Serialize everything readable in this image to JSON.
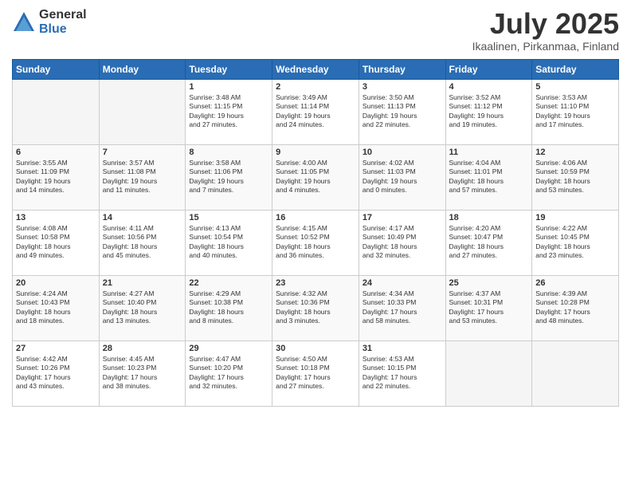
{
  "logo": {
    "general": "General",
    "blue": "Blue"
  },
  "header": {
    "month": "July 2025",
    "location": "Ikaalinen, Pirkanmaa, Finland"
  },
  "weekdays": [
    "Sunday",
    "Monday",
    "Tuesday",
    "Wednesday",
    "Thursday",
    "Friday",
    "Saturday"
  ],
  "weeks": [
    [
      {
        "day": "",
        "info": ""
      },
      {
        "day": "",
        "info": ""
      },
      {
        "day": "1",
        "info": "Sunrise: 3:48 AM\nSunset: 11:15 PM\nDaylight: 19 hours\nand 27 minutes."
      },
      {
        "day": "2",
        "info": "Sunrise: 3:49 AM\nSunset: 11:14 PM\nDaylight: 19 hours\nand 24 minutes."
      },
      {
        "day": "3",
        "info": "Sunrise: 3:50 AM\nSunset: 11:13 PM\nDaylight: 19 hours\nand 22 minutes."
      },
      {
        "day": "4",
        "info": "Sunrise: 3:52 AM\nSunset: 11:12 PM\nDaylight: 19 hours\nand 19 minutes."
      },
      {
        "day": "5",
        "info": "Sunrise: 3:53 AM\nSunset: 11:10 PM\nDaylight: 19 hours\nand 17 minutes."
      }
    ],
    [
      {
        "day": "6",
        "info": "Sunrise: 3:55 AM\nSunset: 11:09 PM\nDaylight: 19 hours\nand 14 minutes."
      },
      {
        "day": "7",
        "info": "Sunrise: 3:57 AM\nSunset: 11:08 PM\nDaylight: 19 hours\nand 11 minutes."
      },
      {
        "day": "8",
        "info": "Sunrise: 3:58 AM\nSunset: 11:06 PM\nDaylight: 19 hours\nand 7 minutes."
      },
      {
        "day": "9",
        "info": "Sunrise: 4:00 AM\nSunset: 11:05 PM\nDaylight: 19 hours\nand 4 minutes."
      },
      {
        "day": "10",
        "info": "Sunrise: 4:02 AM\nSunset: 11:03 PM\nDaylight: 19 hours\nand 0 minutes."
      },
      {
        "day": "11",
        "info": "Sunrise: 4:04 AM\nSunset: 11:01 PM\nDaylight: 18 hours\nand 57 minutes."
      },
      {
        "day": "12",
        "info": "Sunrise: 4:06 AM\nSunset: 10:59 PM\nDaylight: 18 hours\nand 53 minutes."
      }
    ],
    [
      {
        "day": "13",
        "info": "Sunrise: 4:08 AM\nSunset: 10:58 PM\nDaylight: 18 hours\nand 49 minutes."
      },
      {
        "day": "14",
        "info": "Sunrise: 4:11 AM\nSunset: 10:56 PM\nDaylight: 18 hours\nand 45 minutes."
      },
      {
        "day": "15",
        "info": "Sunrise: 4:13 AM\nSunset: 10:54 PM\nDaylight: 18 hours\nand 40 minutes."
      },
      {
        "day": "16",
        "info": "Sunrise: 4:15 AM\nSunset: 10:52 PM\nDaylight: 18 hours\nand 36 minutes."
      },
      {
        "day": "17",
        "info": "Sunrise: 4:17 AM\nSunset: 10:49 PM\nDaylight: 18 hours\nand 32 minutes."
      },
      {
        "day": "18",
        "info": "Sunrise: 4:20 AM\nSunset: 10:47 PM\nDaylight: 18 hours\nand 27 minutes."
      },
      {
        "day": "19",
        "info": "Sunrise: 4:22 AM\nSunset: 10:45 PM\nDaylight: 18 hours\nand 23 minutes."
      }
    ],
    [
      {
        "day": "20",
        "info": "Sunrise: 4:24 AM\nSunset: 10:43 PM\nDaylight: 18 hours\nand 18 minutes."
      },
      {
        "day": "21",
        "info": "Sunrise: 4:27 AM\nSunset: 10:40 PM\nDaylight: 18 hours\nand 13 minutes."
      },
      {
        "day": "22",
        "info": "Sunrise: 4:29 AM\nSunset: 10:38 PM\nDaylight: 18 hours\nand 8 minutes."
      },
      {
        "day": "23",
        "info": "Sunrise: 4:32 AM\nSunset: 10:36 PM\nDaylight: 18 hours\nand 3 minutes."
      },
      {
        "day": "24",
        "info": "Sunrise: 4:34 AM\nSunset: 10:33 PM\nDaylight: 17 hours\nand 58 minutes."
      },
      {
        "day": "25",
        "info": "Sunrise: 4:37 AM\nSunset: 10:31 PM\nDaylight: 17 hours\nand 53 minutes."
      },
      {
        "day": "26",
        "info": "Sunrise: 4:39 AM\nSunset: 10:28 PM\nDaylight: 17 hours\nand 48 minutes."
      }
    ],
    [
      {
        "day": "27",
        "info": "Sunrise: 4:42 AM\nSunset: 10:26 PM\nDaylight: 17 hours\nand 43 minutes."
      },
      {
        "day": "28",
        "info": "Sunrise: 4:45 AM\nSunset: 10:23 PM\nDaylight: 17 hours\nand 38 minutes."
      },
      {
        "day": "29",
        "info": "Sunrise: 4:47 AM\nSunset: 10:20 PM\nDaylight: 17 hours\nand 32 minutes."
      },
      {
        "day": "30",
        "info": "Sunrise: 4:50 AM\nSunset: 10:18 PM\nDaylight: 17 hours\nand 27 minutes."
      },
      {
        "day": "31",
        "info": "Sunrise: 4:53 AM\nSunset: 10:15 PM\nDaylight: 17 hours\nand 22 minutes."
      },
      {
        "day": "",
        "info": ""
      },
      {
        "day": "",
        "info": ""
      }
    ]
  ]
}
